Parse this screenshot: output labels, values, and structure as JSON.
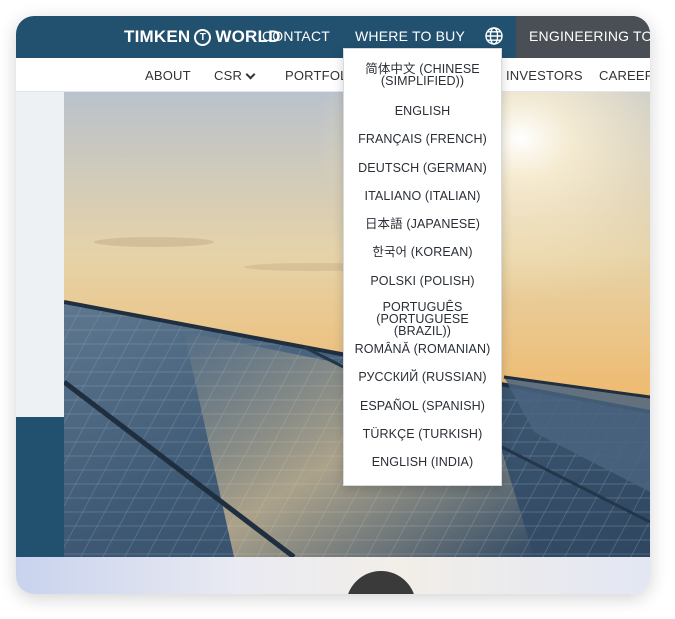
{
  "header": {
    "logo_text_left": "TIMKEN",
    "logo_mark": "T",
    "logo_text_right": "WORLD",
    "contact_label": "CONTACT",
    "where_to_buy_label": "WHERE TO BUY",
    "language_icon": "globe-icon",
    "engineering_tools_label": "ENGINEERING TOOLS"
  },
  "subnav": {
    "items": [
      {
        "label": "ABOUT"
      },
      {
        "label": "CSR",
        "has_dropdown": true
      },
      {
        "label": "PORTFOLIO"
      },
      {
        "label": "INVESTORS"
      },
      {
        "label": "CAREERS"
      }
    ]
  },
  "language_menu": {
    "items": [
      {
        "label": "简体中文 (CHINESE (SIMPLIFIED))"
      },
      {
        "label": "ENGLISH"
      },
      {
        "label": "FRANÇAIS (FRENCH)"
      },
      {
        "label": "DEUTSCH (GERMAN)"
      },
      {
        "label": "ITALIANO (ITALIAN)"
      },
      {
        "label": "日本語 (JAPANESE)"
      },
      {
        "label": "한국어 (KOREAN)"
      },
      {
        "label": "POLSKI (POLISH)"
      },
      {
        "label": "PORTUGUÊS (PORTUGUESE (BRAZIL))"
      },
      {
        "label": "ROMÂNĂ (ROMANIAN)"
      },
      {
        "label": "РУССКИЙ (RUSSIAN)"
      },
      {
        "label": "ESPAÑOL (SPANISH)"
      },
      {
        "label": "TÜRKÇE (TURKISH)"
      },
      {
        "label": "ENGLISH (INDIA)"
      }
    ]
  },
  "colors": {
    "brand_navy": "#22506f",
    "tools_gray": "#4a4f55"
  }
}
